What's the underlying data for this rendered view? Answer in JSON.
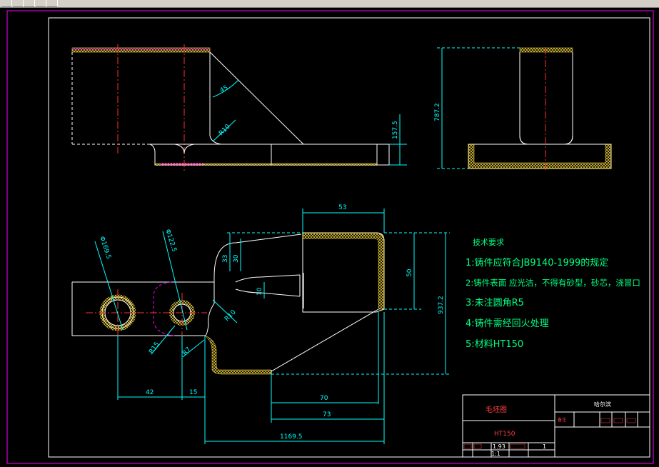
{
  "colors": {
    "background": "#000000",
    "outline": "#ffffff",
    "dimension": "#00ffff",
    "notes": "#00ff80",
    "centerline": "#ff3030",
    "hidden": "#ff00ff",
    "hatch": "#ffe040",
    "titleblock": "#ff4040"
  },
  "toolbar": {
    "icons": [
      "new-icon",
      "open-icon",
      "save-icon",
      "print-icon",
      "undo-icon"
    ]
  },
  "dimensions": {
    "top_height": "157.5",
    "side_height": "787.2",
    "angle": "45",
    "r10_top": "R10",
    "d53": "53",
    "d33": "33",
    "d30": "30",
    "d10": "10",
    "d50": "50",
    "d937": "937.2",
    "dia1": "Φ169.5",
    "dia2": "Φ122.5",
    "r10_front": "R10",
    "r15": "R15",
    "r7": "R7",
    "d42": "42",
    "d15": "15",
    "d70": "70",
    "d73": "73",
    "d1169": "1169.5"
  },
  "notes": {
    "title": "技术要求",
    "lines": [
      "1:铸件应符合JB9140-1999的规定",
      "2:铸件表面 应光洁，不得有砂型，砂芯，浇冒口",
      "3:未注圆角R5",
      "4:铸件需经回火处理",
      "5:材料HT150"
    ]
  },
  "title_block": {
    "drawing_name": "毛坯图",
    "material": "HT150",
    "company": "哈尔滨",
    "scale_label": "1:1",
    "sheet_label": "1",
    "ratio_label": "1.93",
    "small_cell": "备注"
  }
}
